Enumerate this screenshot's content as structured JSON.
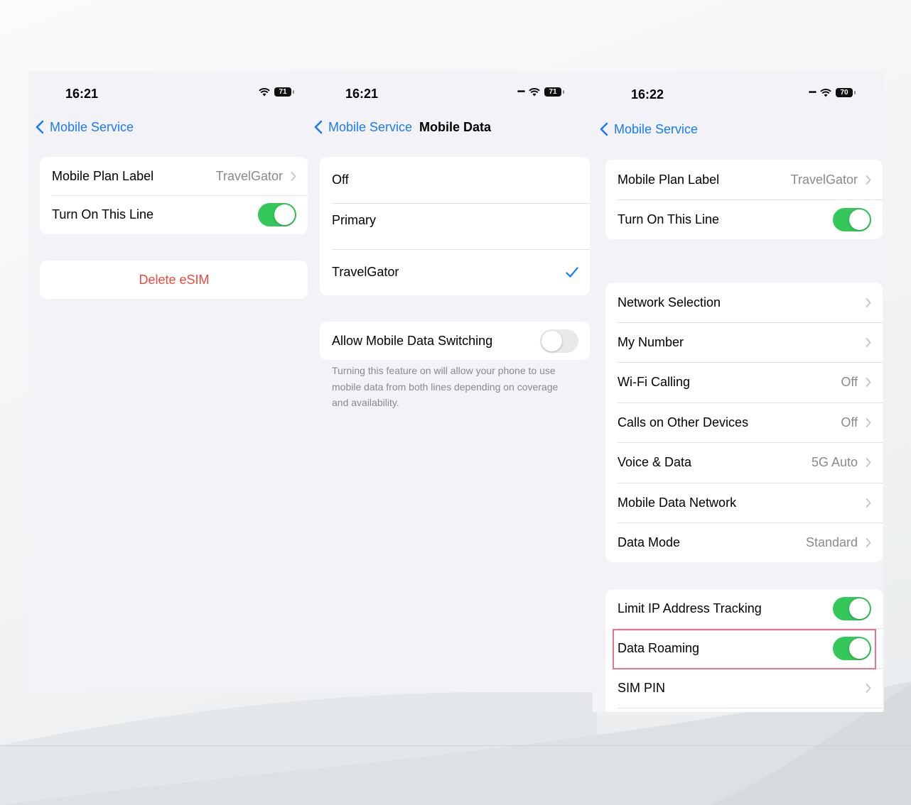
{
  "colors": {
    "accent": "#1a7cf5",
    "toggle_on": "#34c759",
    "destructive": "#f0473c",
    "highlight": "#e9738c"
  },
  "screen1": {
    "time": "16:21",
    "battery": "71",
    "back_label": "Mobile Service",
    "plan_label": "Mobile Plan Label",
    "plan_value": "TravelGator",
    "turn_on_label": "Turn On This Line",
    "turn_on_state": true,
    "delete_label": "Delete eSIM"
  },
  "screen2": {
    "time": "16:21",
    "battery": "71",
    "back_label": "Mobile Service",
    "title": "Mobile Data",
    "options": [
      "Off",
      "Primary",
      "TravelGator"
    ],
    "selected_option": "TravelGator",
    "switching_label": "Allow Mobile Data Switching",
    "switching_state": false,
    "footnote": "Turning this feature on will allow your phone to use mobile data from both lines depending on coverage and availability."
  },
  "screen3": {
    "time": "16:22",
    "battery": "70",
    "back_label": "Mobile Service",
    "plan_label": "Mobile Plan Label",
    "plan_value": "TravelGator",
    "turn_on_label": "Turn On This Line",
    "turn_on_state": true,
    "network_rows": [
      {
        "label": "Network Selection",
        "value": ""
      },
      {
        "label": "My Number",
        "value": ""
      },
      {
        "label": "Wi-Fi Calling",
        "value": "Off"
      },
      {
        "label": "Calls on Other Devices",
        "value": "Off"
      },
      {
        "label": "Voice & Data",
        "value": "5G Auto"
      },
      {
        "label": "Mobile Data Network",
        "value": ""
      },
      {
        "label": "Data Mode",
        "value": "Standard"
      }
    ],
    "limit_ip_label": "Limit IP Address Tracking",
    "limit_ip_state": true,
    "roaming_label": "Data Roaming",
    "roaming_state": true,
    "sim_pin_label": "SIM PIN"
  }
}
